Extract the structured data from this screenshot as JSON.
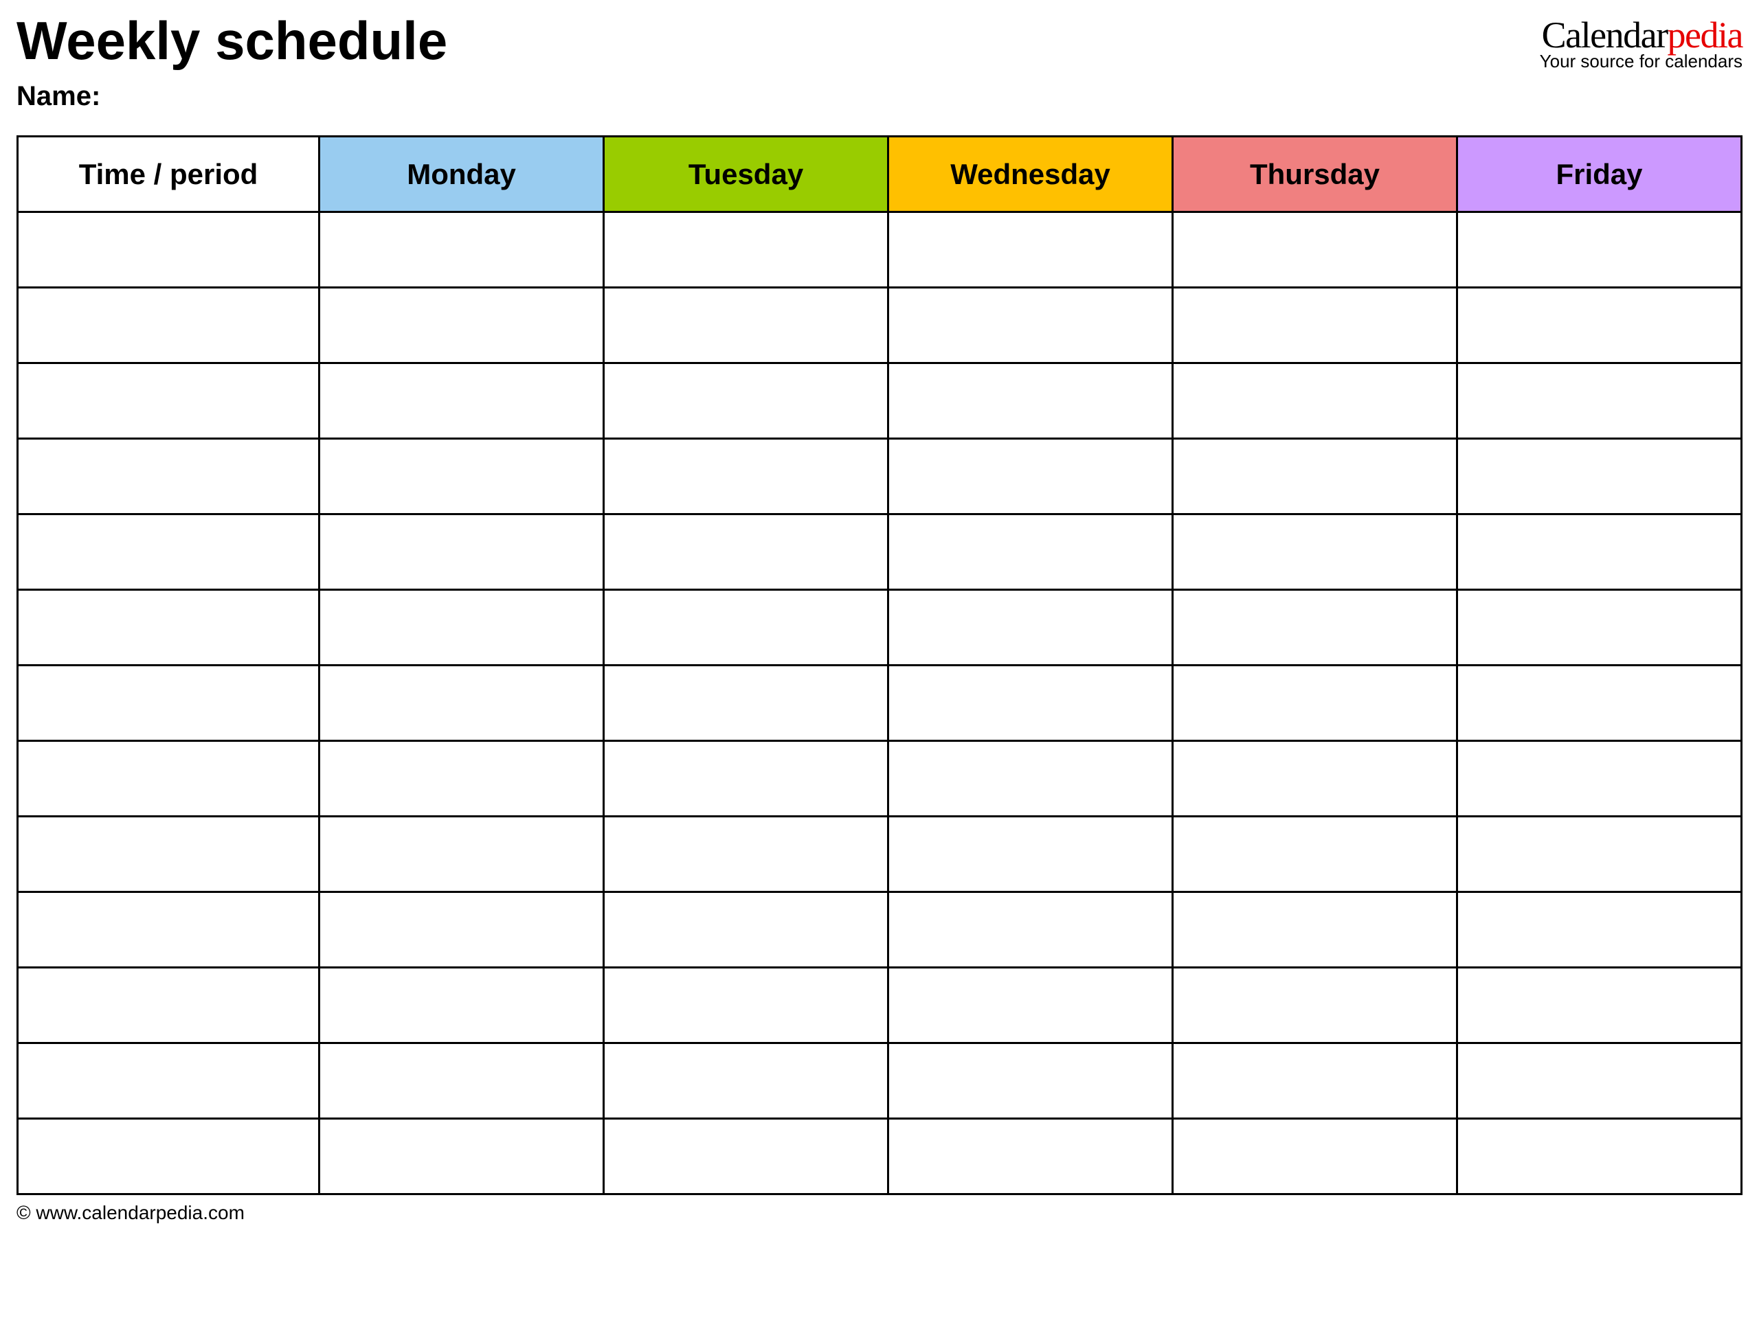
{
  "header": {
    "title": "Weekly schedule",
    "name_label": "Name:"
  },
  "brand": {
    "part1": "Calendar",
    "part2": "pedia",
    "tagline": "Your source for calendars"
  },
  "table": {
    "time_header": "Time / period",
    "days": [
      "Monday",
      "Tuesday",
      "Wednesday",
      "Thursday",
      "Friday"
    ],
    "row_count": 13
  },
  "footer": {
    "copyright": "© www.calendarpedia.com"
  },
  "colors": {
    "monday": "#99ccf0",
    "tuesday": "#99cc00",
    "wednesday": "#ffc000",
    "thursday": "#f08080",
    "friday": "#cc99ff"
  }
}
